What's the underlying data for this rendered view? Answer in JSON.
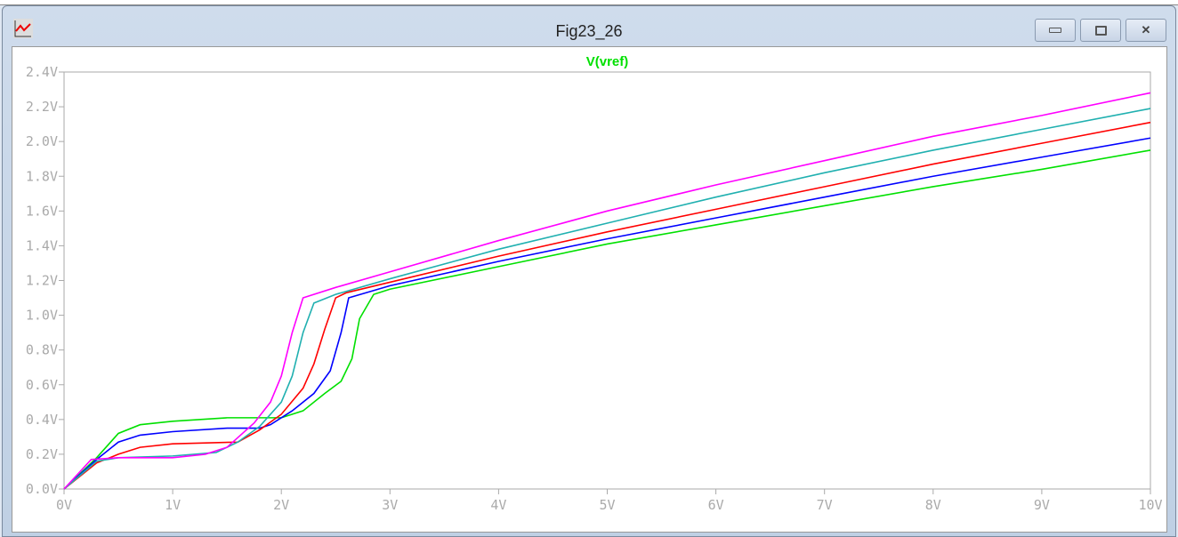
{
  "window": {
    "title": "Fig23_26",
    "buttons": [
      "minimize",
      "maximize",
      "close"
    ]
  },
  "chart_data": {
    "type": "line",
    "title": "V(vref)",
    "title_color": "#00e000",
    "xlabel": "",
    "ylabel": "",
    "xlim": [
      0,
      10
    ],
    "ylim": [
      0,
      2.4
    ],
    "x_ticks": [
      "0V",
      "1V",
      "2V",
      "3V",
      "4V",
      "5V",
      "6V",
      "7V",
      "8V",
      "9V",
      "10V"
    ],
    "y_ticks": [
      "0.0V",
      "0.2V",
      "0.4V",
      "0.6V",
      "0.8V",
      "1.0V",
      "1.2V",
      "1.4V",
      "1.6V",
      "1.8V",
      "2.0V",
      "2.2V",
      "2.4V"
    ],
    "grid": false,
    "series": [
      {
        "name": "green",
        "color": "#00e000",
        "points": [
          [
            0,
            0
          ],
          [
            0.3,
            0.18
          ],
          [
            0.5,
            0.32
          ],
          [
            0.7,
            0.37
          ],
          [
            1,
            0.39
          ],
          [
            1.5,
            0.41
          ],
          [
            2,
            0.41
          ],
          [
            2.2,
            0.45
          ],
          [
            2.4,
            0.55
          ],
          [
            2.55,
            0.62
          ],
          [
            2.65,
            0.75
          ],
          [
            2.72,
            0.98
          ],
          [
            2.85,
            1.12
          ],
          [
            3,
            1.15
          ],
          [
            4,
            1.28
          ],
          [
            5,
            1.41
          ],
          [
            6,
            1.52
          ],
          [
            7,
            1.63
          ],
          [
            8,
            1.74
          ],
          [
            9,
            1.84
          ],
          [
            10,
            1.95
          ]
        ]
      },
      {
        "name": "blue",
        "color": "#0000ff",
        "points": [
          [
            0,
            0
          ],
          [
            0.3,
            0.17
          ],
          [
            0.5,
            0.27
          ],
          [
            0.7,
            0.31
          ],
          [
            1,
            0.33
          ],
          [
            1.5,
            0.35
          ],
          [
            1.8,
            0.35
          ],
          [
            1.9,
            0.37
          ],
          [
            2.1,
            0.45
          ],
          [
            2.3,
            0.55
          ],
          [
            2.45,
            0.68
          ],
          [
            2.55,
            0.9
          ],
          [
            2.62,
            1.1
          ],
          [
            3,
            1.17
          ],
          [
            4,
            1.31
          ],
          [
            5,
            1.44
          ],
          [
            6,
            1.56
          ],
          [
            7,
            1.68
          ],
          [
            8,
            1.8
          ],
          [
            9,
            1.91
          ],
          [
            10,
            2.02
          ]
        ]
      },
      {
        "name": "red",
        "color": "#ff0000",
        "points": [
          [
            0,
            0
          ],
          [
            0.3,
            0.15
          ],
          [
            0.5,
            0.2
          ],
          [
            0.7,
            0.24
          ],
          [
            1,
            0.26
          ],
          [
            1.6,
            0.27
          ],
          [
            1.8,
            0.34
          ],
          [
            2,
            0.43
          ],
          [
            2.2,
            0.58
          ],
          [
            2.3,
            0.72
          ],
          [
            2.4,
            0.92
          ],
          [
            2.5,
            1.1
          ],
          [
            2.6,
            1.13
          ],
          [
            3,
            1.19
          ],
          [
            4,
            1.34
          ],
          [
            5,
            1.48
          ],
          [
            6,
            1.61
          ],
          [
            7,
            1.74
          ],
          [
            8,
            1.87
          ],
          [
            9,
            1.99
          ],
          [
            10,
            2.11
          ]
        ]
      },
      {
        "name": "cyan",
        "color": "#20b0b0",
        "points": [
          [
            0,
            0
          ],
          [
            0.3,
            0.16
          ],
          [
            0.5,
            0.18
          ],
          [
            1,
            0.19
          ],
          [
            1.4,
            0.21
          ],
          [
            1.6,
            0.27
          ],
          [
            1.8,
            0.36
          ],
          [
            2,
            0.5
          ],
          [
            2.1,
            0.65
          ],
          [
            2.2,
            0.9
          ],
          [
            2.3,
            1.07
          ],
          [
            2.5,
            1.12
          ],
          [
            3,
            1.21
          ],
          [
            4,
            1.38
          ],
          [
            5,
            1.53
          ],
          [
            6,
            1.68
          ],
          [
            7,
            1.82
          ],
          [
            8,
            1.95
          ],
          [
            9,
            2.07
          ],
          [
            10,
            2.19
          ]
        ]
      },
      {
        "name": "magenta",
        "color": "#ff00ff",
        "points": [
          [
            0,
            0
          ],
          [
            0.25,
            0.17
          ],
          [
            0.5,
            0.18
          ],
          [
            1,
            0.18
          ],
          [
            1.3,
            0.2
          ],
          [
            1.5,
            0.24
          ],
          [
            1.75,
            0.38
          ],
          [
            1.9,
            0.5
          ],
          [
            2,
            0.65
          ],
          [
            2.1,
            0.9
          ],
          [
            2.2,
            1.1
          ],
          [
            2.5,
            1.16
          ],
          [
            3,
            1.25
          ],
          [
            4,
            1.43
          ],
          [
            5,
            1.6
          ],
          [
            6,
            1.75
          ],
          [
            7,
            1.89
          ],
          [
            8,
            2.03
          ],
          [
            9,
            2.15
          ],
          [
            10,
            2.28
          ]
        ]
      }
    ]
  }
}
